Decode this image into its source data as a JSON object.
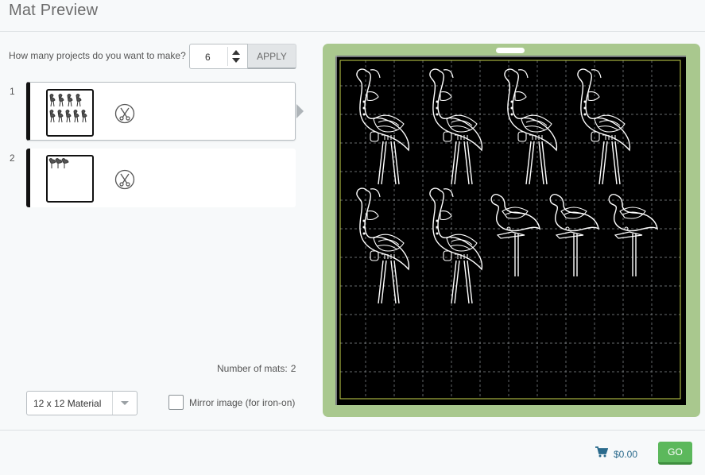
{
  "page": {
    "title": "Mat Preview"
  },
  "projects": {
    "label": "How many projects do you want to make?",
    "count_value": "6",
    "apply_label": "APPLY"
  },
  "mats": [
    {
      "number": "1",
      "selected": true
    },
    {
      "number": "2",
      "selected": false
    }
  ],
  "summary": {
    "number_of_mats_label": "Number of mats:",
    "number_of_mats_value": "2"
  },
  "material": {
    "selected": "12 x 12 Material"
  },
  "mirror": {
    "label": "Mirror image (for iron-on)",
    "checked": false
  },
  "footer": {
    "price": "$0.00",
    "go_label": "GO"
  },
  "colors": {
    "mat_green": "#a9c88e",
    "mat_black": "#000000",
    "go_green": "#5cb85c",
    "link_blue": "#2a6a8c"
  }
}
